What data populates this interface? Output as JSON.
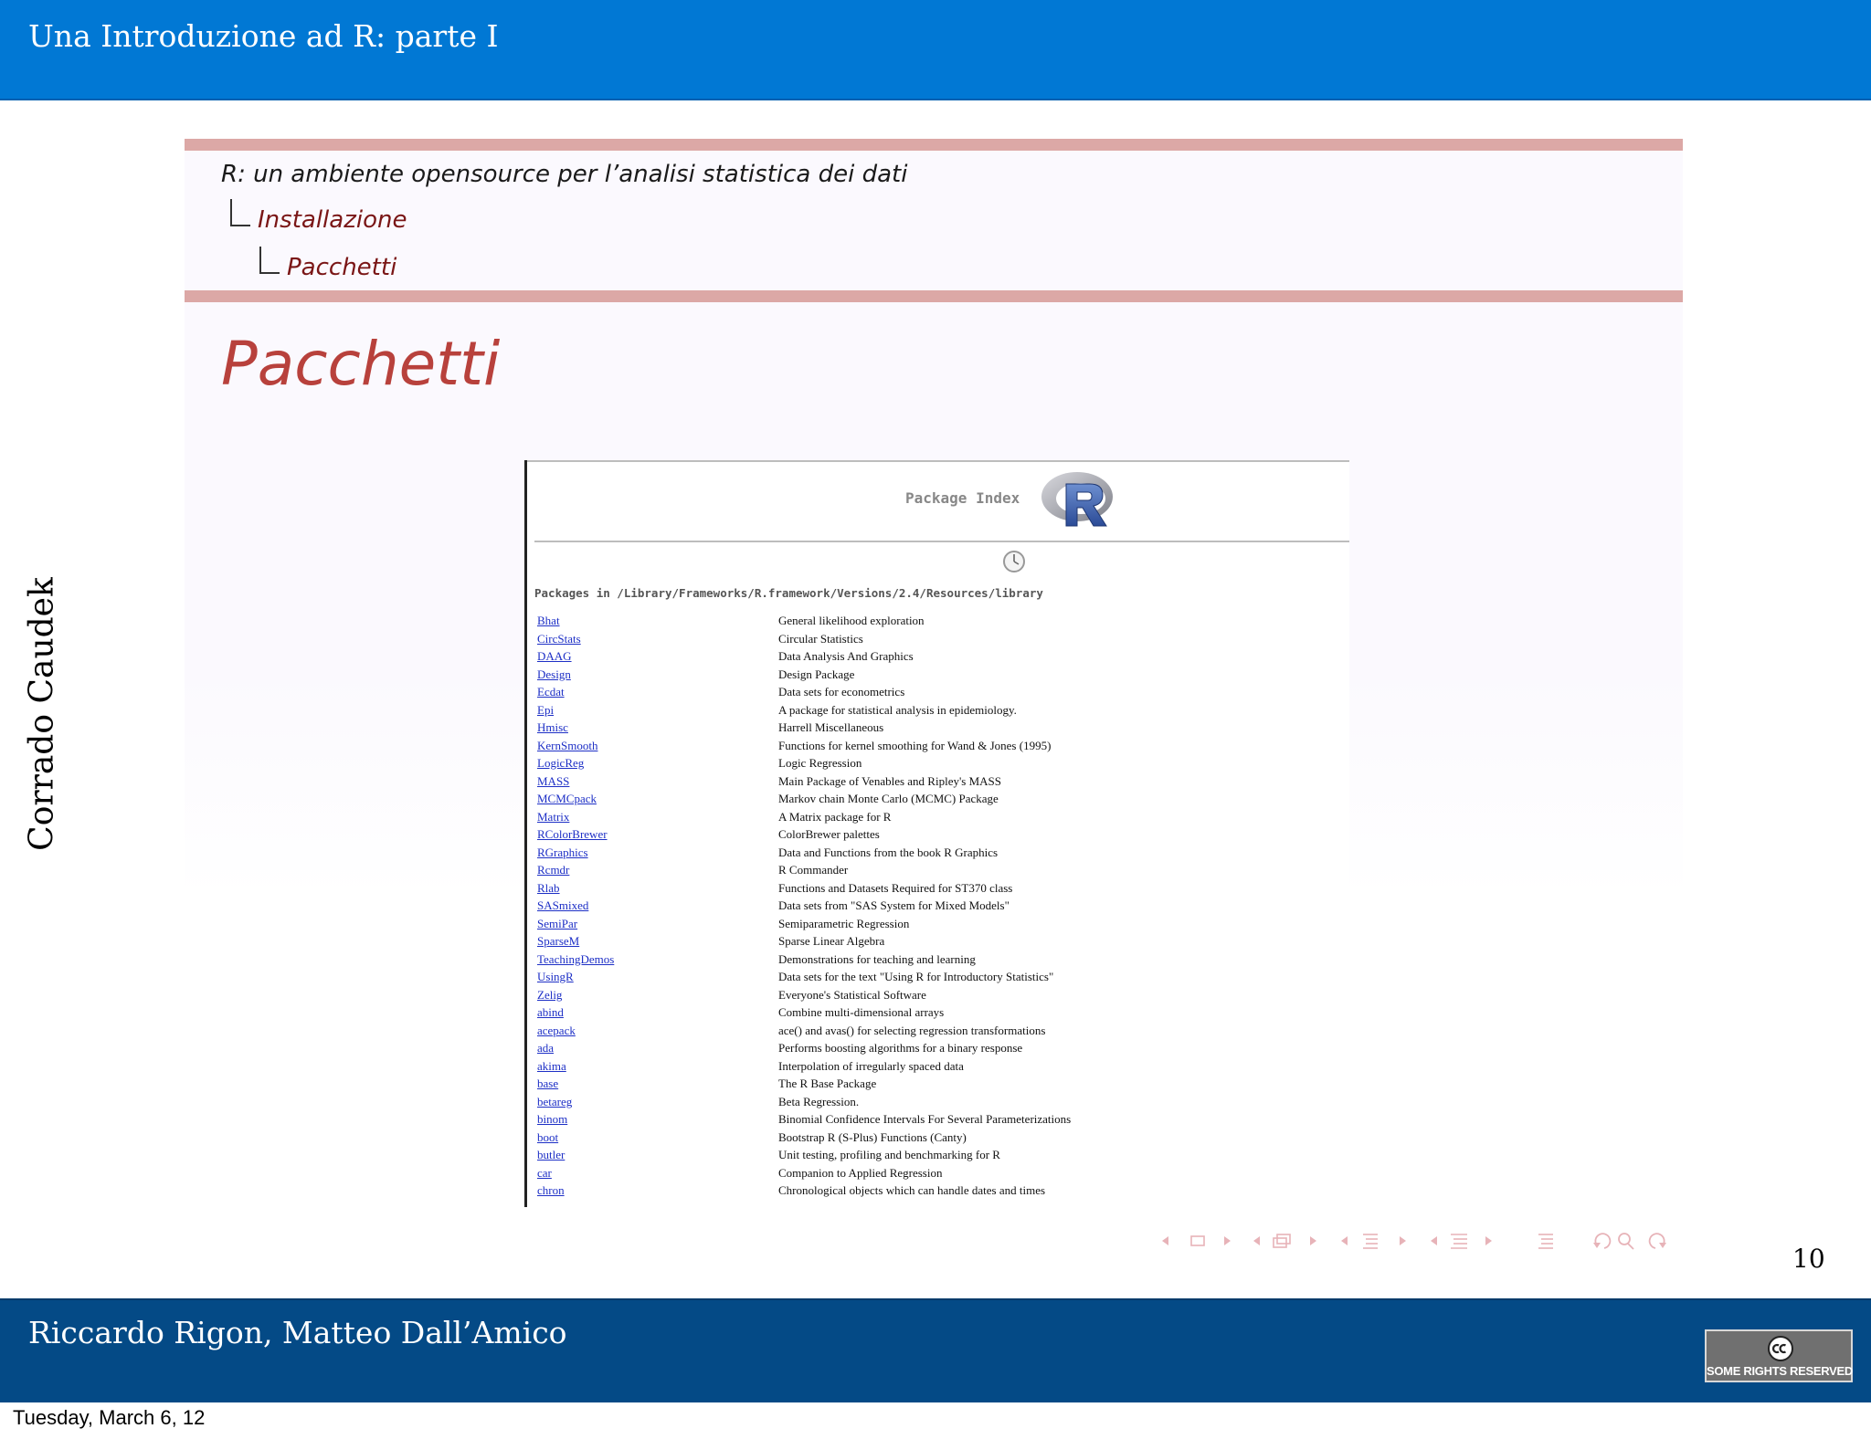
{
  "header": {
    "title": "Una Introduzione ad R: parte I"
  },
  "sidebar": {
    "author": "Corrado Caudek"
  },
  "breadcrumb": {
    "section": "R: un ambiente opensource per l’analisi statistica dei dati",
    "subsection": "Installazione",
    "subsubsection": "Pacchetti"
  },
  "frame": {
    "title": "Pacchetti"
  },
  "screenshot": {
    "header_title": "Package Index",
    "path": "Packages in /Library/Frameworks/R.framework/Versions/2.4/Resources/library",
    "packages": [
      {
        "name": "Bhat",
        "desc": "General likelihood exploration"
      },
      {
        "name": "CircStats",
        "desc": "Circular Statistics"
      },
      {
        "name": "DAAG",
        "desc": "Data Analysis And Graphics"
      },
      {
        "name": "Design",
        "desc": "Design Package"
      },
      {
        "name": "Ecdat",
        "desc": "Data sets for econometrics"
      },
      {
        "name": "Epi",
        "desc": "A package for statistical analysis in epidemiology."
      },
      {
        "name": "Hmisc",
        "desc": "Harrell Miscellaneous"
      },
      {
        "name": "KernSmooth",
        "desc": "Functions for kernel smoothing for Wand & Jones (1995)"
      },
      {
        "name": "LogicReg",
        "desc": "Logic Regression"
      },
      {
        "name": "MASS",
        "desc": "Main Package of Venables and Ripley's MASS"
      },
      {
        "name": "MCMCpack",
        "desc": "Markov chain Monte Carlo (MCMC) Package"
      },
      {
        "name": "Matrix",
        "desc": "A Matrix package for R"
      },
      {
        "name": "RColorBrewer",
        "desc": "ColorBrewer palettes"
      },
      {
        "name": "RGraphics",
        "desc": "Data and Functions from the book R Graphics"
      },
      {
        "name": "Rcmdr",
        "desc": "R Commander"
      },
      {
        "name": "Rlab",
        "desc": "Functions and Datasets Required for ST370 class"
      },
      {
        "name": "SASmixed",
        "desc": "Data sets from \"SAS System for Mixed Models\""
      },
      {
        "name": "SemiPar",
        "desc": "Semiparametric Regression"
      },
      {
        "name": "SparseM",
        "desc": "Sparse Linear Algebra"
      },
      {
        "name": "TeachingDemos",
        "desc": "Demonstrations for teaching and learning"
      },
      {
        "name": "UsingR",
        "desc": "Data sets for the text \"Using R for Introductory Statistics\""
      },
      {
        "name": "Zelig",
        "desc": "Everyone's Statistical Software"
      },
      {
        "name": "abind",
        "desc": "Combine multi-dimensional arrays"
      },
      {
        "name": "acepack",
        "desc": "ace() and avas() for selecting regression transformations"
      },
      {
        "name": "ada",
        "desc": "Performs boosting algorithms for a binary response"
      },
      {
        "name": "akima",
        "desc": "Interpolation of irregularly spaced data"
      },
      {
        "name": "base",
        "desc": "The R Base Package"
      },
      {
        "name": "betareg",
        "desc": "Beta Regression."
      },
      {
        "name": "binom",
        "desc": "Binomial Confidence Intervals For Several Parameterizations"
      },
      {
        "name": "boot",
        "desc": "Bootstrap R (S-Plus) Functions (Canty)"
      },
      {
        "name": "butler",
        "desc": "Unit testing, profiling and benchmarking for R"
      },
      {
        "name": "car",
        "desc": "Companion to Applied Regression"
      },
      {
        "name": "chron",
        "desc": "Chronological objects which can handle dates and times"
      }
    ]
  },
  "navigation": {
    "icons": [
      "nav-frame-icon",
      "nav-subsection-icon",
      "nav-section-icon",
      "nav-document-icon",
      "nav-outline-icon",
      "nav-back-search-forward-icon"
    ],
    "color": "#e7b3b8"
  },
  "page_number": "10",
  "footer": {
    "authors": "Riccardo Rigon, Matteo Dall’Amico",
    "license_badge": "SOME RIGHTS RESERVED"
  },
  "date_stamp": "Tuesday, March 6, 12",
  "colors": {
    "header_bg": "#0178d4",
    "footer_bg": "#044a86",
    "rule": "#dca8a6",
    "frame_title": "#b8413c",
    "breadcrumb_sub": "#7a1616",
    "link": "#1d2fc6"
  }
}
